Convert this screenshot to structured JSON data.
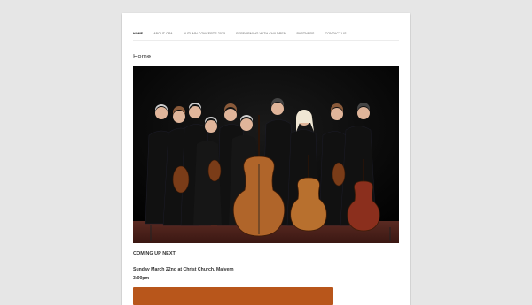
{
  "nav": {
    "items": [
      {
        "label": "HOME",
        "active": true
      },
      {
        "label": "ABOUT OPA",
        "active": false
      },
      {
        "label": "AUTUMN CONCERTS 2025",
        "active": false
      },
      {
        "label": "PERFORMING WITH CHILDREN",
        "active": false
      },
      {
        "label": "PARTNERS",
        "active": false
      },
      {
        "label": "CONTACT US",
        "active": false
      }
    ]
  },
  "page": {
    "title": "Home"
  },
  "hero": {
    "image": "orchestra-group-photo"
  },
  "content": {
    "heading": "COMING UP NEXT",
    "event_line": "Sunday March 22nd at Christ Church, Malvern",
    "event_time": "3:00pm"
  },
  "colors": {
    "background": "#e6e6e6",
    "accent_button": "#b8561b"
  }
}
